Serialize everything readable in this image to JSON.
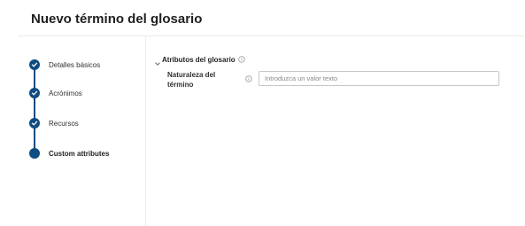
{
  "page": {
    "title": "Nuevo término del glosario"
  },
  "steps": [
    {
      "label": "Detalles básicos",
      "status": "completed"
    },
    {
      "label": "Acrónimos",
      "status": "completed"
    },
    {
      "label": "Recursos",
      "status": "completed"
    },
    {
      "label": "Custom attributes",
      "status": "current"
    }
  ],
  "section": {
    "title": "Atributos del glosario",
    "expanded": true
  },
  "field": {
    "label": "Naturaleza del término",
    "value": "",
    "placeholder": "Introduzca un valor texto"
  },
  "colors": {
    "accent": "#0f4c81",
    "divider": "#edebe9",
    "text": "#323130",
    "placeholder": "#8a8886"
  },
  "icons": [
    "check-icon",
    "chevron-down-icon",
    "info-icon"
  ]
}
